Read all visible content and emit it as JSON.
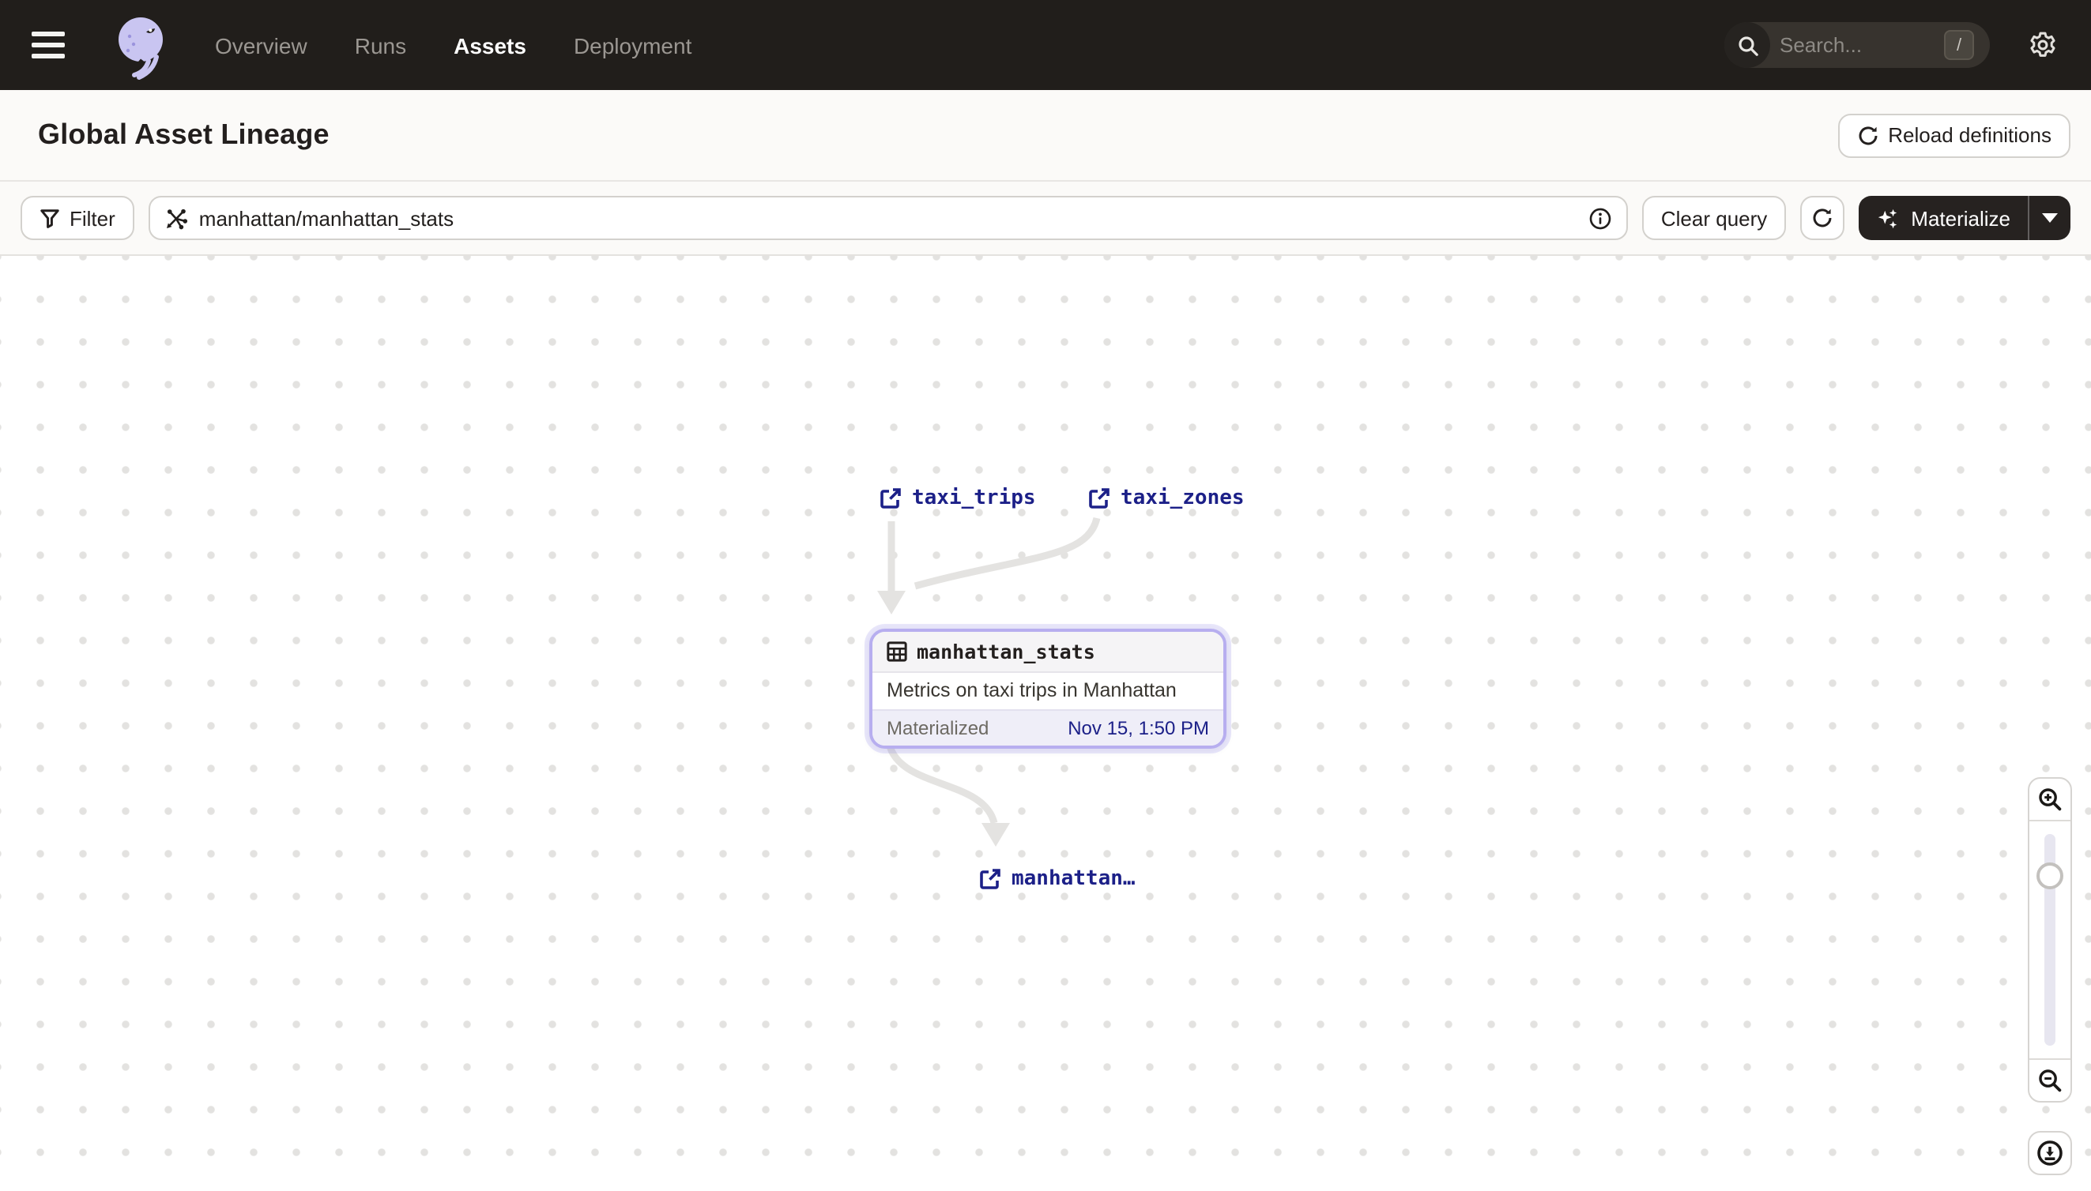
{
  "nav": {
    "links": [
      {
        "label": "Overview",
        "active": false
      },
      {
        "label": "Runs",
        "active": false
      },
      {
        "label": "Assets",
        "active": true
      },
      {
        "label": "Deployment",
        "active": false
      }
    ],
    "search_placeholder": "Search...",
    "search_shortcut": "/"
  },
  "header": {
    "title": "Global Asset Lineage",
    "reload_button": "Reload definitions"
  },
  "toolbar": {
    "filter_label": "Filter",
    "query_value": "manhattan/manhattan_stats",
    "clear_button": "Clear query",
    "materialize_label": "Materialize"
  },
  "graph": {
    "upstream_nodes": [
      {
        "label": "taxi_trips"
      },
      {
        "label": "taxi_zones"
      }
    ],
    "selected_asset": {
      "name": "manhattan_stats",
      "description": "Metrics on taxi trips in Manhattan",
      "status_label": "Materialized",
      "status_time": "Nov 15, 1:50 PM"
    },
    "downstream_node": {
      "label": "manhattan…"
    }
  },
  "colors": {
    "nav_background": "#211e1b",
    "asset_link": "#1c2088",
    "selection_border": "#b7aeef",
    "edge": "#e4e3e1",
    "materialize_button": "#262220"
  },
  "icons": {
    "menu": "hamburger-icon",
    "logo": "dagster-logo",
    "search": "search-icon",
    "settings": "gear-icon",
    "filter": "filter-icon",
    "asset_graph": "asset-graph-icon",
    "info": "info-icon",
    "refresh": "refresh-icon",
    "sparkle": "sparkle-icon",
    "caret": "chevron-down-icon",
    "external": "external-link-icon",
    "table": "table-icon",
    "zoom_in": "zoom-in-icon",
    "zoom_out": "zoom-out-icon",
    "fit": "download-view-icon"
  }
}
